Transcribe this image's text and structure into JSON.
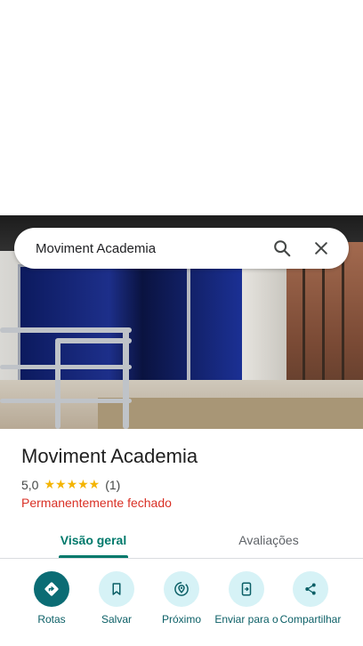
{
  "search": {
    "query": "Moviment Academia"
  },
  "place": {
    "title": "Moviment Academia",
    "rating": "5,0",
    "stars": "★★★★★",
    "reviews_count": "(1)",
    "status": "Permanentemente fechado"
  },
  "tabs": [
    {
      "label": "Visão geral",
      "active": true
    },
    {
      "label": "Avaliações",
      "active": false
    }
  ],
  "actions": [
    {
      "label": "Rotas",
      "icon": "directions-icon"
    },
    {
      "label": "Salvar",
      "icon": "bookmark-icon"
    },
    {
      "label": "Próximo",
      "icon": "nearby-icon"
    },
    {
      "label": "Enviar para o",
      "icon": "send-to-phone-icon"
    },
    {
      "label": "Compartilhar",
      "icon": "share-icon"
    }
  ],
  "colors": {
    "accent": "#00796b",
    "status_closed": "#d93025",
    "star": "#f4b400",
    "action_bg": "#d6f2f6",
    "action_primary": "#0b6c74"
  }
}
